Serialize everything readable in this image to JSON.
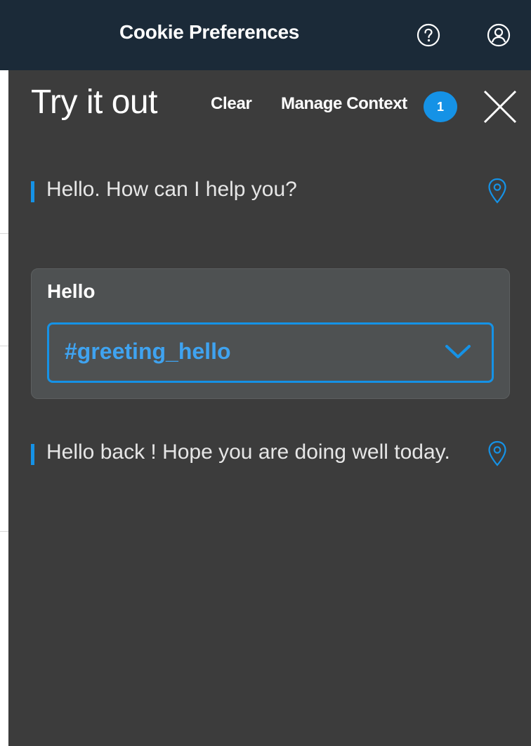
{
  "header": {
    "title": "Cookie Preferences",
    "help_icon": "question-circle-icon",
    "user_icon": "user-avatar-icon"
  },
  "panel": {
    "title": "Try it out",
    "clear_label": "Clear",
    "manage_context_label": "Manage Context",
    "context_count": "1",
    "close_icon": "close-icon"
  },
  "conversation": {
    "messages": [
      {
        "role": "bot",
        "text": "Hello. How can I help you?",
        "icon": "location-pin-icon"
      },
      {
        "role": "user",
        "text": "Hello",
        "intent": "#greeting_hello",
        "select_icon": "chevron-down-icon"
      },
      {
        "role": "bot",
        "text": "Hello back ! Hope you are doing well today.",
        "icon": "location-pin-icon"
      }
    ]
  },
  "colors": {
    "header_bg": "#1b2a38",
    "panel_bg": "#3c3c3c",
    "accent": "#1592e6",
    "card_bg": "#4e5152"
  }
}
